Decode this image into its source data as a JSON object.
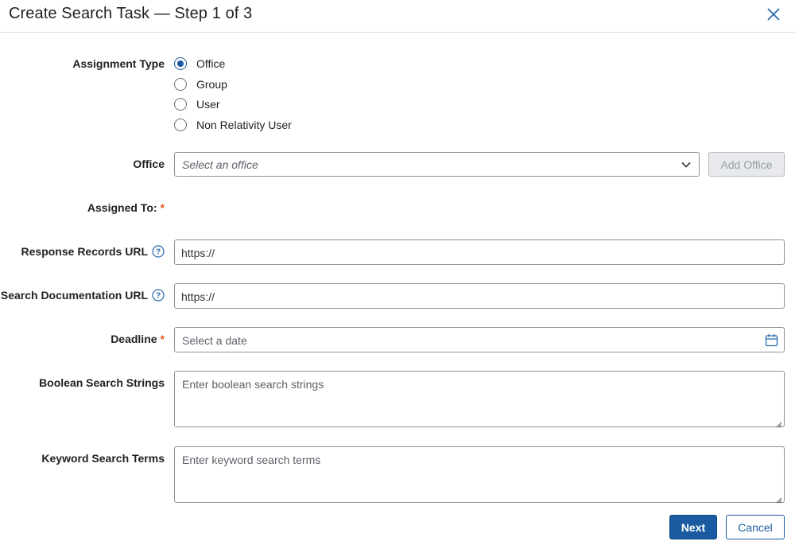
{
  "dialog": {
    "title": "Create Search Task — Step 1 of 3",
    "close_icon": "close-icon"
  },
  "assignment_type": {
    "label": "Assignment Type",
    "options": [
      "Office",
      "Group",
      "User",
      "Non Relativity User"
    ],
    "selected": "Office"
  },
  "office": {
    "label": "Office",
    "placeholder": "Select an office",
    "add_button": "Add Office"
  },
  "assigned_to": {
    "label": "Assigned To:",
    "required_mark": "*"
  },
  "response_records_url": {
    "label": "Response Records URL",
    "value": "https://",
    "help_icon": "help-circle-icon"
  },
  "search_documentation_url": {
    "label": "Search Documentation URL",
    "value": "https://",
    "help_icon": "help-circle-icon"
  },
  "deadline": {
    "label": "Deadline",
    "required_mark": "*",
    "placeholder": "Select a date",
    "icon": "calendar-icon"
  },
  "boolean_search": {
    "label": "Boolean Search Strings",
    "placeholder": "Enter boolean search strings"
  },
  "keyword_search": {
    "label": "Keyword Search Terms",
    "placeholder": "Enter keyword search terms"
  },
  "footer": {
    "next_label": "Next",
    "cancel_label": "Cancel"
  },
  "colors": {
    "primary": "#1a5aa0",
    "required": "#e05a1f",
    "border": "#8d9299"
  }
}
